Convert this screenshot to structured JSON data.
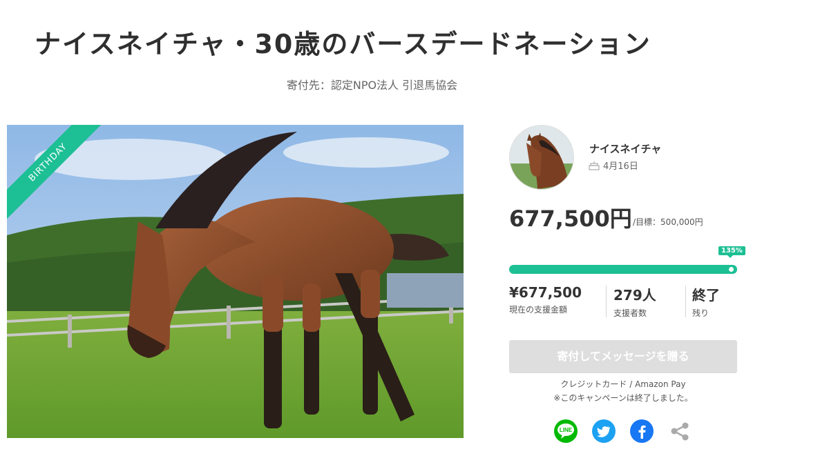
{
  "page": {
    "title": "ナイスネイチャ・30歳のバースデードネーション",
    "organization": "寄付先：認定NPO法人 引退馬協会"
  },
  "hero": {
    "ribbon_label": "BIRTHDAY"
  },
  "horse": {
    "name": "ナイスネイチャ",
    "birthday": "4月16日"
  },
  "funding": {
    "amount": "677,500円",
    "goal": "/目標：500,000円",
    "percent_label": "135%",
    "progress": 1.0
  },
  "stats": [
    {
      "value": "¥677,500",
      "label": "現在の支援金額"
    },
    {
      "value": "279人",
      "label": "支援者数"
    },
    {
      "value": "終了",
      "label": "残り"
    }
  ],
  "donate": {
    "button_label": "寄付してメッセージを贈る",
    "payment_methods": "クレジットカード / Amazon Pay",
    "ended_note": "※このキャンペーンは終了しました。"
  },
  "share": {
    "line_label": "LINE",
    "colors": {
      "line": "#00b900",
      "twitter": "#1da1f2",
      "facebook": "#1877f2",
      "generic": "#aaaaaa"
    }
  },
  "colors": {
    "accent": "#1dbf94"
  }
}
